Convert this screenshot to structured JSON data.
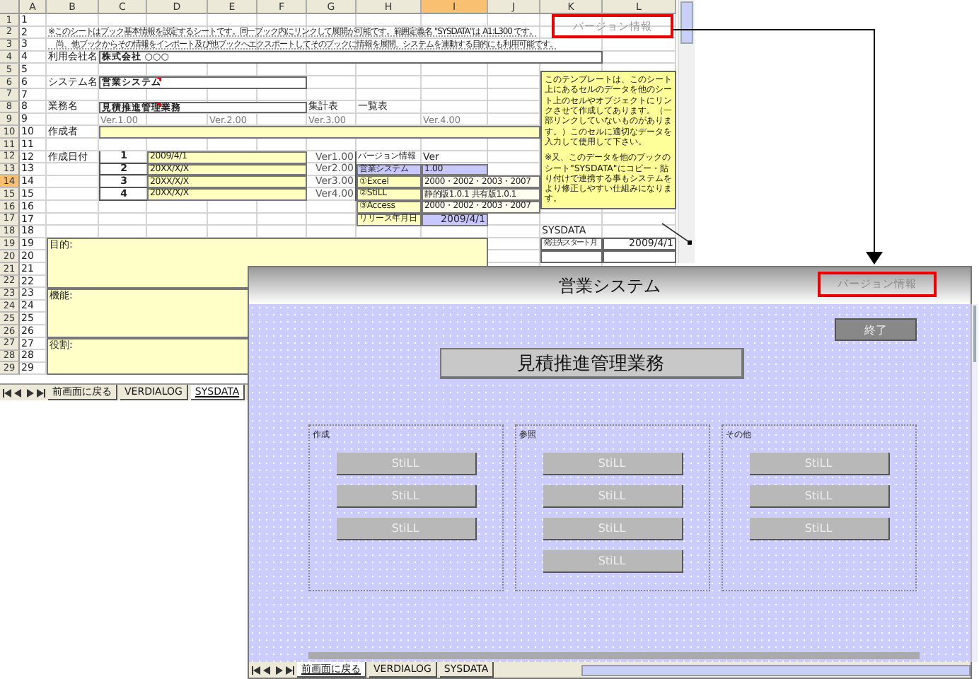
{
  "spreadsheet": {
    "column_headers": [
      {
        "label": "A",
        "selected": false
      },
      {
        "label": "B",
        "selected": false
      },
      {
        "label": "C",
        "selected": false
      },
      {
        "label": "D",
        "selected": false
      },
      {
        "label": "E",
        "selected": false
      },
      {
        "label": "F",
        "selected": false
      },
      {
        "label": "G",
        "selected": false
      },
      {
        "label": "H",
        "selected": false
      },
      {
        "label": "I",
        "selected": true
      },
      {
        "label": "J",
        "selected": false
      },
      {
        "label": "K",
        "selected": false
      },
      {
        "label": "L",
        "selected": false
      }
    ],
    "rows": [
      {
        "number": "1",
        "selected": false,
        "items": [
          {
            "text": "1",
            "kind": "plain"
          }
        ]
      },
      {
        "number": "2",
        "selected": false,
        "items": [
          {
            "text": "2",
            "kind": "plain"
          },
          {
            "text": "※このシートはブック基本情報を設定するシートです。同一ブック内にリンクして展開が可能です。範囲定義名 \"SYSDATA\"は A1:L300 です。",
            "kind": "small"
          }
        ]
      },
      {
        "number": "3",
        "selected": false,
        "items": [
          {
            "text": "3",
            "kind": "plain"
          },
          {
            "text": "　尚、他ブックからその情報をインポート及び他ブックへエクスポートしてそのブックに情報を展開、システムを連動する目的にも利用可能です。",
            "kind": "small"
          }
        ]
      },
      {
        "number": "4",
        "selected": false,
        "items": [
          {
            "text": "4",
            "kind": "plain"
          },
          {
            "text": "利用会社名",
            "kind": "plain"
          },
          {
            "text": "株式会社 ○○○",
            "kind": "boxed"
          }
        ]
      },
      {
        "number": "5",
        "selected": false,
        "items": [
          {
            "text": "5",
            "kind": "plain"
          }
        ]
      },
      {
        "number": "6",
        "selected": false,
        "items": [
          {
            "text": "6",
            "kind": "plain"
          },
          {
            "text": "システム名",
            "kind": "plain"
          },
          {
            "text": "営業システム",
            "kind": "boxed",
            "comment": true
          }
        ]
      },
      {
        "number": "7",
        "selected": false,
        "items": [
          {
            "text": "7",
            "kind": "plain"
          }
        ]
      },
      {
        "number": "8",
        "selected": false,
        "items": [
          {
            "text": "8",
            "kind": "plain"
          },
          {
            "text": "業務名",
            "kind": "plain"
          },
          {
            "text": "見積推進管理業務",
            "kind": "boxed",
            "comment": true
          },
          {
            "text": "集計表",
            "kind": "plain"
          },
          {
            "text": "一覧表",
            "kind": "plain"
          }
        ]
      },
      {
        "number": "9",
        "selected": false,
        "items": [
          {
            "text": "9",
            "kind": "plain"
          },
          {
            "text": "Ver.1.00",
            "kind": "version"
          },
          {
            "text": "Ver.2.00",
            "kind": "version"
          },
          {
            "text": "Ver.3.00",
            "kind": "version"
          },
          {
            "text": "Ver.4.00",
            "kind": "version"
          }
        ]
      },
      {
        "number": "10",
        "selected": false,
        "items": [
          {
            "text": "10",
            "kind": "plain"
          },
          {
            "text": "作成者",
            "kind": "plain"
          },
          {
            "kind": "yellow"
          }
        ]
      },
      {
        "number": "11",
        "selected": false,
        "items": [
          {
            "text": "11",
            "kind": "plain"
          }
        ]
      },
      {
        "number": "12",
        "selected": false,
        "items": [
          {
            "text": "12",
            "kind": "plain"
          },
          {
            "text": "作成日付",
            "kind": "plain"
          },
          {
            "text": "1",
            "kind": "center"
          },
          {
            "text": "2009/4/1",
            "kind": "yellow"
          },
          {
            "text": "Ver1.00",
            "kind": "right"
          },
          {
            "text": "バージョン情報",
            "kind": "label"
          },
          {
            "text": "Ver",
            "kind": "plain"
          }
        ]
      },
      {
        "number": "13",
        "selected": false,
        "items": [
          {
            "text": "13",
            "kind": "plain"
          },
          {
            "text": "2",
            "kind": "center"
          },
          {
            "text": "20XX/X/X",
            "kind": "yellow"
          },
          {
            "text": "Ver2.00",
            "kind": "right"
          },
          {
            "text": "営業システム",
            "kind": "lavender"
          },
          {
            "text": "1.00",
            "kind": "lavender"
          }
        ]
      },
      {
        "number": "14",
        "selected": true,
        "items": [
          {
            "text": "14",
            "kind": "plain"
          },
          {
            "text": "3",
            "kind": "center"
          },
          {
            "text": "20XX/X/X",
            "kind": "yellow"
          },
          {
            "text": "Ver3.00",
            "kind": "right"
          },
          {
            "text": "①Excel",
            "kind": "yellow"
          },
          {
            "text": "2000・2002・2003・2007",
            "kind": "tiny"
          }
        ]
      },
      {
        "number": "15",
        "selected": false,
        "items": [
          {
            "text": "15",
            "kind": "plain"
          },
          {
            "text": "4",
            "kind": "center"
          },
          {
            "text": "20XX/X/X",
            "kind": "yellow"
          },
          {
            "text": "Ver4.00",
            "kind": "right"
          },
          {
            "text": "②StiLL",
            "kind": "yellow"
          },
          {
            "text": "静的版1.0.1 共有版1.0.1",
            "kind": "tiny"
          }
        ]
      },
      {
        "number": "16",
        "selected": false,
        "items": [
          {
            "text": "16",
            "kind": "plain"
          },
          {
            "text": "③Access",
            "kind": "yellow"
          },
          {
            "text": "2000・2002・2003・2007",
            "kind": "tiny"
          }
        ]
      },
      {
        "number": "17",
        "selected": false,
        "items": [
          {
            "text": "17",
            "kind": "plain"
          },
          {
            "text": "リリース年月日",
            "kind": "yellow"
          },
          {
            "text": "2009/4/1",
            "kind": "lavender-right"
          }
        ]
      },
      {
        "number": "18",
        "selected": false,
        "items": [
          {
            "text": "18",
            "kind": "plain"
          },
          {
            "text": "SYSDATA",
            "kind": "plain"
          }
        ]
      },
      {
        "number": "19",
        "selected": false,
        "items": [
          {
            "text": "19",
            "kind": "plain"
          },
          {
            "text": "目的:",
            "kind": "area"
          },
          {
            "text": "発注先スタート月",
            "kind": "tiny-boxed"
          },
          {
            "text": "2009/4/1",
            "kind": "boxed-right"
          }
        ]
      },
      {
        "number": "20",
        "selected": false,
        "items": [
          {
            "text": "20",
            "kind": "plain"
          },
          {
            "kind": "boxed"
          },
          {
            "kind": "boxed"
          }
        ]
      },
      {
        "number": "21",
        "selected": false,
        "items": [
          {
            "text": "21",
            "kind": "plain"
          }
        ]
      },
      {
        "number": "22",
        "selected": false,
        "items": [
          {
            "text": "22",
            "kind": "plain"
          }
        ]
      },
      {
        "number": "23",
        "selected": false,
        "items": [
          {
            "text": "23",
            "kind": "plain"
          },
          {
            "text": "機能:",
            "kind": "area"
          }
        ]
      },
      {
        "number": "24",
        "selected": false,
        "items": [
          {
            "text": "24",
            "kind": "plain"
          }
        ]
      },
      {
        "number": "25",
        "selected": false,
        "items": [
          {
            "text": "25",
            "kind": "plain"
          }
        ]
      },
      {
        "number": "26",
        "selected": false,
        "items": [
          {
            "text": "26",
            "kind": "plain"
          }
        ]
      },
      {
        "number": "27",
        "selected": false,
        "items": [
          {
            "text": "27",
            "kind": "plain"
          },
          {
            "text": "役割:",
            "kind": "area"
          }
        ]
      },
      {
        "number": "28",
        "selected": false,
        "items": [
          {
            "text": "28",
            "kind": "plain"
          }
        ]
      },
      {
        "number": "29",
        "selected": false,
        "items": [
          {
            "text": "29",
            "kind": "plain"
          }
        ]
      }
    ],
    "version_label": "バージョン情報",
    "note": "このテンプレートは、このシート上にあるセルのデータを他のシート上のセルやオブジェクトにリンクさせて作成してあります。（一部リンクしていないものがあります。）このセルに適切なデータを入力して使用して下さい。",
    "note_2": "※又、このデータを他のブックのシート\"SYSDATA\"にコピー・貼り付けで連携する事もシステムをより修正しやすい仕組みになります。",
    "sheet_tabs": [
      {
        "label": "前画面に戻る",
        "selected": false
      },
      {
        "label": "VERDIALOG",
        "selected": false
      },
      {
        "label": "SYSDATA",
        "selected": true
      }
    ]
  },
  "form": {
    "title": "営業システム",
    "version_label": "バージョン情報",
    "close_button": "終了",
    "main_button": "見積推進管理業務",
    "groups": [
      {
        "label": "作成",
        "buttons": [
          "StiLL",
          "StiLL",
          "StiLL"
        ]
      },
      {
        "label": "参照",
        "buttons": [
          "StiLL",
          "StiLL",
          "StiLL",
          "StiLL"
        ]
      },
      {
        "label": "その他",
        "buttons": [
          "StiLL",
          "StiLL",
          "StiLL"
        ]
      }
    ],
    "sheet_tabs": [
      {
        "label": "前画面に戻る",
        "selected": true
      },
      {
        "label": "VERDIALOG",
        "selected": false
      },
      {
        "label": "SYSDATA",
        "selected": false
      }
    ]
  }
}
